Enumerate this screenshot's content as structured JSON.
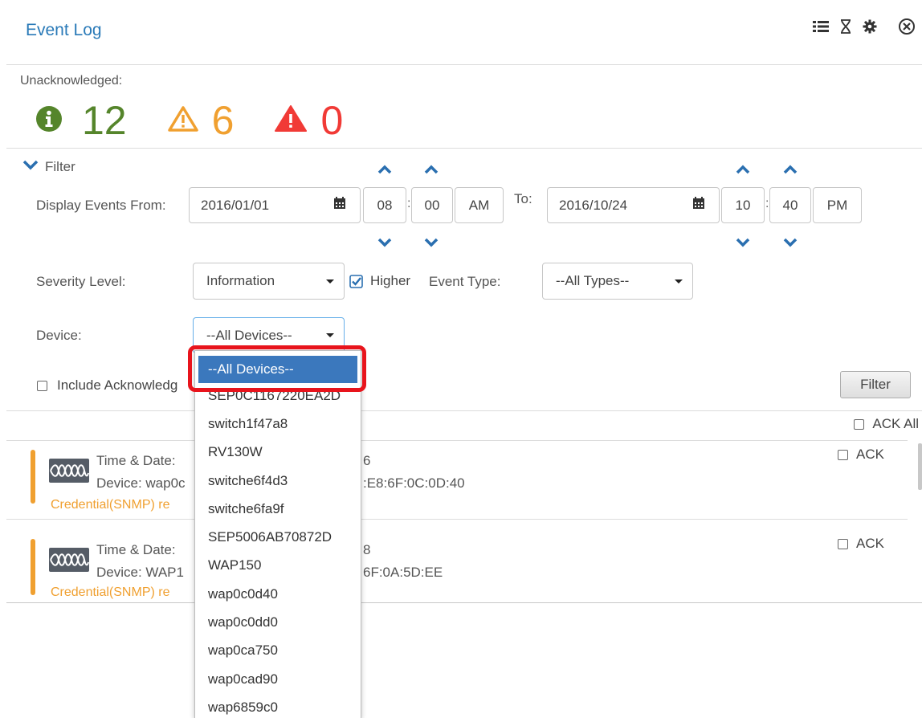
{
  "header": {
    "title": "Event Log",
    "icons": [
      "list-icon",
      "hourglass-icon",
      "gear-icon",
      "close-circle-icon"
    ]
  },
  "summary": {
    "label": "Unacknowledged:",
    "info_count": "12",
    "warning_count": "6",
    "critical_count": "0"
  },
  "filter": {
    "toggle_label": "Filter",
    "from_label": "Display Events From:",
    "from_date": "2016/01/01",
    "from_hour": "08",
    "from_minute": "00",
    "from_ampm": "AM",
    "to_label": "To:",
    "to_date": "2016/10/24",
    "to_hour": "10",
    "to_minute": "40",
    "to_ampm": "PM",
    "severity_label": "Severity Level:",
    "severity_value": "Information",
    "higher_label": "Higher",
    "event_type_label": "Event Type:",
    "event_type_value": "--All Types--",
    "device_label": "Device:",
    "device_value": "--All Devices--",
    "include_ack_label": "Include Acknowledg",
    "filter_button": "Filter"
  },
  "list": {
    "ack_all_label": "ACK All",
    "events": [
      {
        "time_label": "Time & Date:",
        "time_tail": "6",
        "device_label": "Device: wap0c",
        "device_tail": ":E8:6F:0C:0D:40",
        "message": "Credential(SNMP) re",
        "ack_label": "ACK"
      },
      {
        "time_label": "Time & Date:",
        "time_tail": "8",
        "device_label": "Device: WAP1",
        "device_tail": "6F:0A:5D:EE",
        "message": "Credential(SNMP) re",
        "ack_label": "ACK"
      }
    ]
  },
  "dropdown": {
    "options": [
      "--All Devices--",
      "SEP0C1167220EA2D",
      "switch1f47a8",
      "RV130W",
      "switche6f4d3",
      "switche6fa9f",
      "SEP5006AB70872D",
      "WAP150",
      "wap0c0d40",
      "wap0c0dd0",
      "wap0ca750",
      "wap0cad90",
      "wap6859c0"
    ]
  },
  "colors": {
    "accent": "#2a7ab8",
    "info": "#55852b",
    "warning": "#f0a030",
    "critical": "#f13a36",
    "selected": "#3b78bd",
    "highlight": "#e8141c"
  }
}
